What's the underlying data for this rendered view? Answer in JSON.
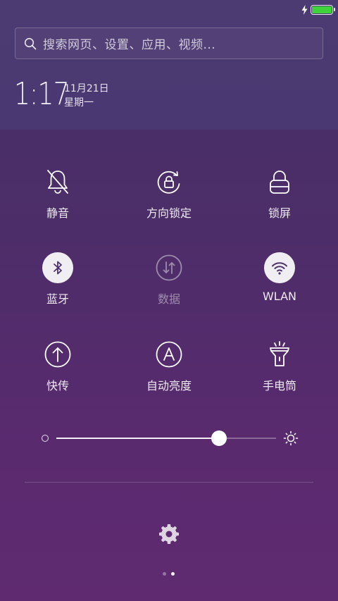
{
  "status_bar": {
    "charging_icon": "lightning-bolt-icon",
    "battery_icon": "battery-icon",
    "battery_level": 1.0,
    "battery_color": "#3fd23b"
  },
  "search": {
    "placeholder": "搜索网页、设置、应用、视频..."
  },
  "clock": {
    "time": "1:17",
    "date": "11月21日",
    "weekday": "星期一"
  },
  "toggles": [
    {
      "label": "静音",
      "icon": "bell-off-icon",
      "active": false,
      "enabled": true
    },
    {
      "label": "方向锁定",
      "icon": "rotation-lock-icon",
      "active": false,
      "enabled": true
    },
    {
      "label": "锁屏",
      "icon": "lock-icon",
      "active": false,
      "enabled": true
    },
    {
      "label": "蓝牙",
      "icon": "bluetooth-icon",
      "active": true,
      "enabled": true
    },
    {
      "label": "数据",
      "icon": "mobile-data-icon",
      "active": false,
      "enabled": false
    },
    {
      "label": "WLAN",
      "icon": "wifi-icon",
      "active": true,
      "enabled": true
    },
    {
      "label": "快传",
      "icon": "quick-transfer-icon",
      "active": false,
      "enabled": true
    },
    {
      "label": "自动亮度",
      "icon": "auto-brightness-icon",
      "active": false,
      "enabled": true
    },
    {
      "label": "手电筒",
      "icon": "flashlight-icon",
      "active": false,
      "enabled": true
    }
  ],
  "brightness": {
    "level": 0.74,
    "min_icon": "brightness-low-icon",
    "max_icon": "brightness-high-icon"
  },
  "settings_icon": "gear-icon",
  "pages": {
    "count": 2,
    "current": 2
  },
  "colors": {
    "accent_active_bg": "#ffffff",
    "active_icon": "#4d3270"
  }
}
